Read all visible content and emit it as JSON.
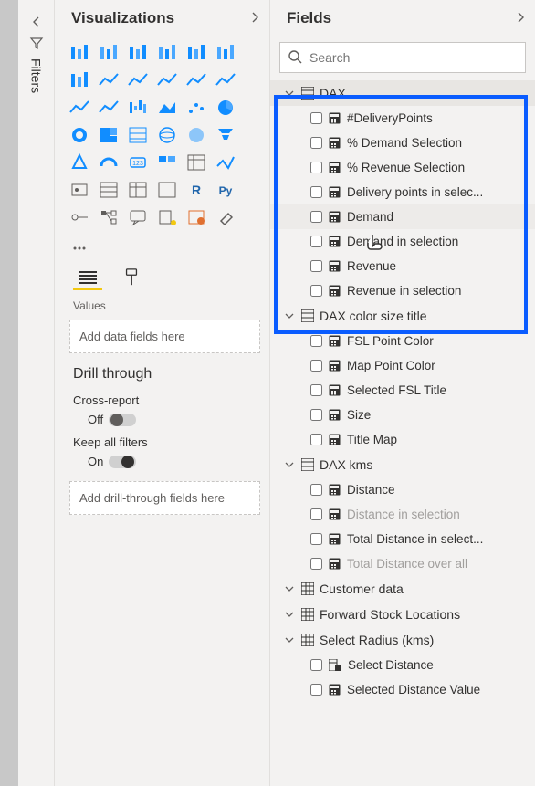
{
  "filters": {
    "label": "Filters"
  },
  "viz": {
    "title": "Visualizations",
    "values_section": "Values",
    "values_placeholder": "Add data fields here",
    "drill_title": "Drill through",
    "cross_report_label": "Cross-report",
    "cross_report_state": "Off",
    "keep_filters_label": "Keep all filters",
    "keep_filters_state": "On",
    "drill_placeholder": "Add drill-through fields here"
  },
  "fields": {
    "title": "Fields",
    "search_placeholder": "Search",
    "tables": [
      {
        "name": "DAX",
        "expanded": true,
        "type": "table",
        "highlighted": true,
        "items": [
          {
            "label": "#DeliveryPoints",
            "kind": "measure"
          },
          {
            "label": "% Demand Selection",
            "kind": "measure"
          },
          {
            "label": "% Revenue Selection",
            "kind": "measure"
          },
          {
            "label": "Delivery points in selec...",
            "kind": "measure"
          },
          {
            "label": "Demand",
            "kind": "measure",
            "hovered": true
          },
          {
            "label": "Demand in selection",
            "kind": "measure"
          },
          {
            "label": "Revenue",
            "kind": "measure"
          },
          {
            "label": "Revenue in selection",
            "kind": "measure"
          }
        ]
      },
      {
        "name": "DAX color size title",
        "expanded": true,
        "type": "table",
        "items": [
          {
            "label": "FSL Point Color",
            "kind": "measure"
          },
          {
            "label": "Map Point Color",
            "kind": "measure"
          },
          {
            "label": "Selected FSL Title",
            "kind": "measure"
          },
          {
            "label": "Size",
            "kind": "measure"
          },
          {
            "label": "Title Map",
            "kind": "measure"
          }
        ]
      },
      {
        "name": "DAX kms",
        "expanded": true,
        "type": "table",
        "items": [
          {
            "label": "Distance",
            "kind": "measure"
          },
          {
            "label": "Distance in selection",
            "kind": "measure",
            "disabled": true
          },
          {
            "label": "Total Distance in select...",
            "kind": "measure"
          },
          {
            "label": "Total Distance over all",
            "kind": "measure",
            "disabled": true
          }
        ]
      },
      {
        "name": "Customer data",
        "expanded": false,
        "type": "datatable"
      },
      {
        "name": "Forward Stock Locations",
        "expanded": false,
        "type": "datatable"
      },
      {
        "name": "Select Radius (kms)",
        "expanded": true,
        "type": "datatable",
        "items": [
          {
            "label": "Select Distance",
            "kind": "column-calc"
          },
          {
            "label": "Selected Distance Value",
            "kind": "measure"
          }
        ]
      }
    ]
  }
}
